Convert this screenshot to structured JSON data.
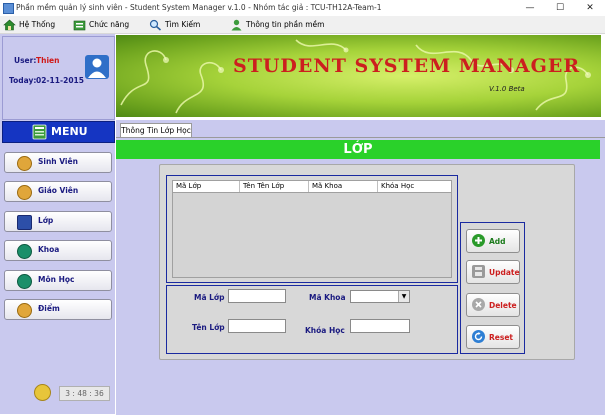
{
  "window": {
    "title": "Phần mềm quản lý sinh viên - Student System Manager v.1.0 - Nhóm tác giả : TCU-TH12A-Team-1",
    "minimize": "—",
    "maximize": "☐",
    "close": "✕"
  },
  "menubar": [
    {
      "label": "Hệ Thống",
      "icon": "home-icon"
    },
    {
      "label": "Chức năng",
      "icon": "function-icon"
    },
    {
      "label": "Tìm Kiếm",
      "icon": "search-icon"
    },
    {
      "label": "Thông tin phần mềm",
      "icon": "user-icon"
    }
  ],
  "user": {
    "user_label": "User:",
    "user_value": "Thien",
    "today_label": "Today:",
    "today_value": "02-11-2015"
  },
  "sidebar": {
    "title": "MENU",
    "items": [
      {
        "label": "Sinh Viên"
      },
      {
        "label": "Giáo Viên"
      },
      {
        "label": "Lớp"
      },
      {
        "label": "Khoa"
      },
      {
        "label": "Môn Học"
      },
      {
        "label": "Điểm"
      }
    ]
  },
  "banner": {
    "title": "STUDENT SYSTEM MANAGER",
    "version": "V.1.0 Beta"
  },
  "tab": {
    "label": "Thông Tin Lớp Học"
  },
  "section": {
    "title": "LỚP"
  },
  "grid": {
    "columns": [
      "Mã Lớp",
      "Tên Tên Lớp",
      "Mã Khoa",
      "Khóa Học"
    ]
  },
  "form": {
    "ma_lop_label": "Mã Lớp",
    "ma_lop_value": "",
    "ten_lop_label": "Tên Lớp",
    "ten_lop_value": "",
    "ma_khoa_label": "Mã Khoa",
    "ma_khoa_value": "",
    "khoa_hoc_label": "Khóa Học",
    "khoa_hoc_value": ""
  },
  "actions": {
    "add": "Add",
    "update": "Update",
    "delete": "Delete",
    "reset": "Reset"
  },
  "clock": {
    "time": "3 : 48 : 36"
  },
  "colors": {
    "sidebar_bg": "#c9c9ee",
    "menu_header": "#1535c2",
    "section_strip": "#2ad12a",
    "banner_green": "#a6d33a",
    "banner_title": "#cc1f1f",
    "add": "#2a9a2a",
    "update": "#cc1f1f",
    "delete": "#cc1f1f",
    "reset": "#cc1f1f"
  }
}
